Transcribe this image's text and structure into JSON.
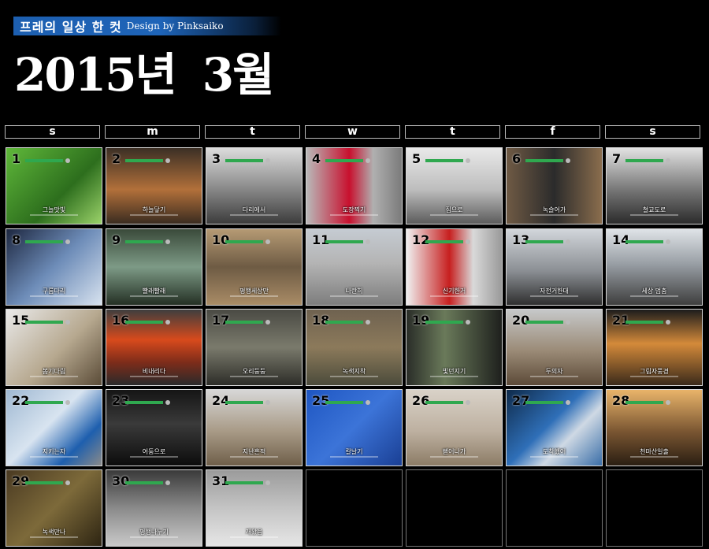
{
  "header": {
    "series_title": "프레의 일상 한 컷",
    "credit": "Design by Pinksaiko",
    "year_label": "2015년",
    "month_label": "3월"
  },
  "weekdays": [
    "s",
    "m",
    "t",
    "w",
    "t",
    "f",
    "s"
  ],
  "days": [
    {
      "day": "1",
      "title": "그늘맛빛",
      "bg": "linear-gradient(135deg,#5fb83a,#2d6e1d 60%,#9bd26a)"
    },
    {
      "day": "2",
      "title": "하늘닿기",
      "bg": "linear-gradient(180deg,#3b2f25,#b2703a 55%,#3a2c20)"
    },
    {
      "day": "3",
      "title": "다리에서",
      "bg": "linear-gradient(180deg,#dcdcdc,#8f8f8f 50%,#3c3c3c)"
    },
    {
      "day": "4",
      "title": "도장찍기",
      "bg": "linear-gradient(90deg,#b9b9b9,#c8102e 45%,#b0b0b0 70%,#7b7b7b)"
    },
    {
      "day": "5",
      "title": "집으로",
      "bg": "linear-gradient(180deg,#e9e9e9,#bdbdbd 55%,#5c5c5c)"
    },
    {
      "day": "6",
      "title": "녹슬어가",
      "bg": "linear-gradient(90deg,#6f5a44,#2b2b2b 50%,#8a6d4d)"
    },
    {
      "day": "7",
      "title": "철교도로",
      "bg": "linear-gradient(180deg,#e2e2e2,#6e6e6e 60%,#2b2b2b)"
    },
    {
      "day": "8",
      "title": "구름다리",
      "bg": "linear-gradient(135deg,#1d2740,#6d8cb8 50%,#d7e2ef)"
    },
    {
      "day": "9",
      "title": "빨래빨래",
      "bg": "linear-gradient(180deg,#3a4a3a,#7d9a86 50%,#243024)"
    },
    {
      "day": "10",
      "title": "평행세상만",
      "bg": "linear-gradient(180deg,#b59a74,#6e5b44 50%,#a98c66)"
    },
    {
      "day": "11",
      "title": "나란히",
      "bg": "linear-gradient(180deg,#c5cbd2,#b4b4b4 45%,#7d7d7d)"
    },
    {
      "day": "12",
      "title": "신기한거",
      "bg": "linear-gradient(90deg,#f0f0f0,#c71f1f 45%,#d9d9d9 70%,#9a9a9a)"
    },
    {
      "day": "13",
      "title": "자전거한대",
      "bg": "linear-gradient(180deg,#d2d6db,#8b8f94 55%,#2f2f2f)"
    },
    {
      "day": "14",
      "title": "세상 멈춤",
      "bg": "linear-gradient(180deg,#dfe3e7,#9aa0a6 45%,#3e3e3e)"
    },
    {
      "day": "15",
      "title": "봄기다림",
      "bg": "linear-gradient(135deg,#e9e9e9,#b7a990 55%,#5a4b37)"
    },
    {
      "day": "16",
      "title": "비내리다",
      "bg": "linear-gradient(180deg,#3e3e3e,#d84a1c 40%,#7d2c1a 70%,#2a2a2a)"
    },
    {
      "day": "17",
      "title": "오리둥둥",
      "bg": "linear-gradient(180deg,#4a4a44,#7a7a6c 50%,#2d2d28)"
    },
    {
      "day": "18",
      "title": "녹색지착",
      "bg": "linear-gradient(180deg,#6f6250,#8c7a5b 50%,#4b4b3b)"
    },
    {
      "day": "19",
      "title": "빛던지기",
      "bg": "linear-gradient(90deg,#2a2d28,#6a7a5a 40%,#1e201d)"
    },
    {
      "day": "20",
      "title": "두의자",
      "bg": "linear-gradient(180deg,#c6c8c9,#9a8a76 55%,#5c4a38)"
    },
    {
      "day": "21",
      "title": "그림자풍경",
      "bg": "linear-gradient(180deg,#1c1c1c,#d48a3a 45%,#3a2a1a)"
    },
    {
      "day": "22",
      "title": "지키는자",
      "bg": "linear-gradient(135deg,#9fb8d2,#d8e4f0 45%,#1e5fae 75%,#8a8a8a)"
    },
    {
      "day": "23",
      "title": "어둠으로",
      "bg": "linear-gradient(180deg,#151515,#3a3a3a 45%,#0c0c0c)"
    },
    {
      "day": "24",
      "title": "지난흔적",
      "bg": "linear-gradient(180deg,#d7d7d7,#a89a86 55%,#6f5f4a)"
    },
    {
      "day": "25",
      "title": "칼날기",
      "bg": "linear-gradient(135deg,#1e56c2,#3c74d8 50%,#1a3f94)"
    },
    {
      "day": "26",
      "title": "뻗어나가",
      "bg": "linear-gradient(180deg,#d9d2c8,#bdb0a0 55%,#8c7c66)"
    },
    {
      "day": "27",
      "title": "도착했어",
      "bg": "linear-gradient(135deg,#0e2a4a,#2f6fb8 45%,#cfd9e4 65%,#3a6ea8)"
    },
    {
      "day": "28",
      "title": "천마산일출",
      "bg": "linear-gradient(180deg,#e9b46a,#7a5632 55%,#2a1e12)"
    },
    {
      "day": "29",
      "title": "녹색만나",
      "bg": "linear-gradient(135deg,#4a3a22,#7d6a3a 50%,#2d2412)"
    },
    {
      "day": "30",
      "title": "평행나누기",
      "bg": "linear-gradient(180deg,#3a3a3a,#8a8a8a 50%,#c9c9c9)"
    },
    {
      "day": "31",
      "title": "개왔음",
      "bg": "linear-gradient(180deg,#9b9b9b,#c4c4c4 50%,#e6e6e6)"
    }
  ]
}
